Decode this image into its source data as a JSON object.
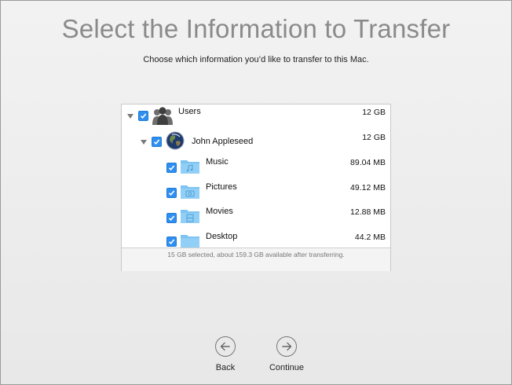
{
  "page": {
    "title": "Select the Information to Transfer",
    "subtitle": "Choose which information you’d like to transfer to this Mac."
  },
  "list": {
    "items": [
      {
        "label": "Users",
        "size": "12 GB",
        "checked": true,
        "icon": "users-group-icon"
      },
      {
        "label": "John Appleseed",
        "size": "12 GB",
        "checked": true,
        "icon": "earth-avatar-icon"
      },
      {
        "label": "Music",
        "size": "89.04 MB",
        "checked": true,
        "icon": "music-folder-icon"
      },
      {
        "label": "Pictures",
        "size": "49.12 MB",
        "checked": true,
        "icon": "pictures-folder-icon"
      },
      {
        "label": "Movies",
        "size": "12.88 MB",
        "checked": true,
        "icon": "movies-folder-icon"
      },
      {
        "label": "Desktop",
        "size": "44.2 MB",
        "checked": true,
        "icon": "desktop-folder-icon"
      }
    ],
    "footer": "15 GB selected, about 159.3 GB available after transferring."
  },
  "nav": {
    "back_label": "Back",
    "continue_label": "Continue"
  },
  "colors": {
    "checkbox": "#2f8ff0",
    "folder": "#7ec3f2",
    "title": "#8a8a8a"
  }
}
